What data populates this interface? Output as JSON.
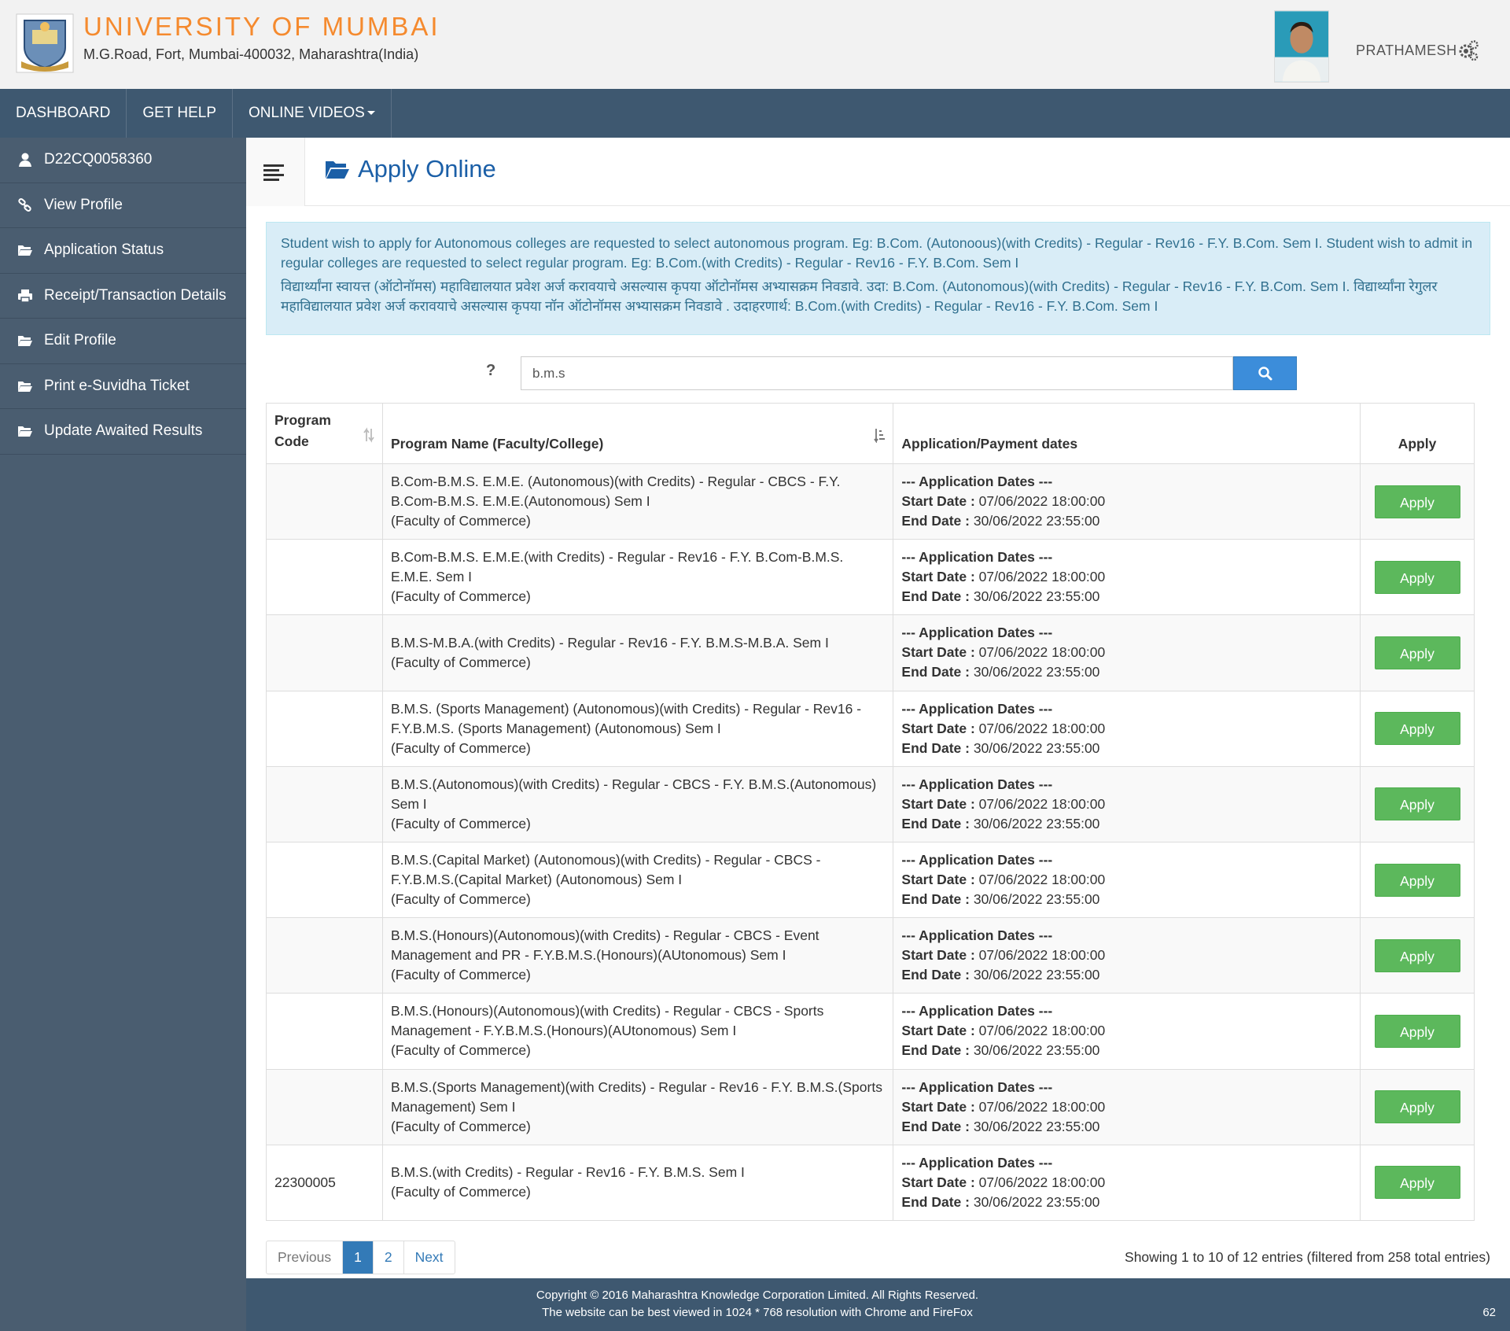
{
  "header": {
    "university": "UNIVERSITY OF MUMBAI",
    "address": "M.G.Road, Fort, Mumbai-400032, Maharashtra(India)",
    "user_name": "PRATHAMESH"
  },
  "nav": {
    "items": [
      "DASHBOARD",
      "GET HELP",
      "ONLINE VIDEOS"
    ]
  },
  "sidebar": {
    "items": [
      {
        "label": "D22CQ0058360",
        "icon": "user-icon"
      },
      {
        "label": "View Profile",
        "icon": "link-icon"
      },
      {
        "label": "Application Status",
        "icon": "folder-open-icon"
      },
      {
        "label": "Receipt/Transaction Details",
        "icon": "print-icon"
      },
      {
        "label": "Edit Profile",
        "icon": "folder-open-icon"
      },
      {
        "label": "Print e-Suvidha Ticket",
        "icon": "folder-open-icon"
      },
      {
        "label": "Update Awaited Results",
        "icon": "folder-open-icon"
      }
    ]
  },
  "page": {
    "title": "Apply Online",
    "alert_en": "Student wish to apply for Autonomous colleges are requested to select autonomous program. Eg: B.Com. (Autonoous)(with Credits) - Regular - Rev16 - F.Y. B.Com. Sem I. Student wish to admit in regular colleges are requested to select regular program. Eg: B.Com.(with Credits) - Regular - Rev16 - F.Y. B.Com. Sem I",
    "alert_mr": "विद्यार्थ्यांना स्वायत्त (ऑटोनॉमस) महाविद्यालयात प्रवेश अर्ज करावयाचे असल्यास कृपया ऑटोनॉमस अभ्यासक्रम निवडावे. उदा: B.Com. (Autonomous)(with Credits) - Regular - Rev16 - F.Y. B.Com. Sem I. विद्यार्थ्यांना रेगुलर महाविद्यालयात प्रवेश अर्ज करावयाचे असल्यास कृपया नॉन ऑटोनॉमस अभ्यासक्रम निवडावे . उदाहरणार्थ: B.Com.(with Credits) - Regular - Rev16 - F.Y. B.Com. Sem I",
    "help_mark": "?",
    "search_value": "b.m.s"
  },
  "table": {
    "headers": {
      "code": "Program Code",
      "name": "Program Name (Faculty/College)",
      "dates": "Application/Payment dates",
      "apply": "Apply"
    },
    "dates_heading": "--- Application Dates ---",
    "start_label": "Start Date :",
    "end_label": "End Date :",
    "apply_label": "Apply",
    "rows": [
      {
        "code": "",
        "name": "B.Com-B.M.S. E.M.E. (Autonomous)(with Credits) - Regular - CBCS - F.Y. B.Com-B.M.S. E.M.E.(Autonomous) Sem I",
        "faculty": "(Faculty of Commerce)",
        "start": "07/06/2022 18:00:00",
        "end": "30/06/2022 23:55:00"
      },
      {
        "code": "",
        "name": "B.Com-B.M.S. E.M.E.(with Credits) - Regular - Rev16 - F.Y. B.Com-B.M.S. E.M.E. Sem I",
        "faculty": "(Faculty of Commerce)",
        "start": "07/06/2022 18:00:00",
        "end": "30/06/2022 23:55:00"
      },
      {
        "code": "",
        "name": "B.M.S-M.B.A.(with Credits) - Regular - Rev16 - F.Y. B.M.S-M.B.A. Sem I",
        "faculty": "(Faculty of Commerce)",
        "start": "07/06/2022 18:00:00",
        "end": "30/06/2022 23:55:00"
      },
      {
        "code": "",
        "name": "B.M.S. (Sports Management) (Autonomous)(with Credits) - Regular - Rev16 - F.Y.B.M.S. (Sports Management) (Autonomous) Sem I",
        "faculty": "(Faculty of Commerce)",
        "start": "07/06/2022 18:00:00",
        "end": "30/06/2022 23:55:00"
      },
      {
        "code": "",
        "name": "B.M.S.(Autonomous)(with Credits) - Regular - CBCS - F.Y. B.M.S.(Autonomous) Sem I",
        "faculty": "(Faculty of Commerce)",
        "start": "07/06/2022 18:00:00",
        "end": "30/06/2022 23:55:00"
      },
      {
        "code": "",
        "name": "B.M.S.(Capital Market) (Autonomous)(with Credits) - Regular - CBCS - F.Y.B.M.S.(Capital Market) (Autonomous) Sem I",
        "faculty": "(Faculty of Commerce)",
        "start": "07/06/2022 18:00:00",
        "end": "30/06/2022 23:55:00"
      },
      {
        "code": "",
        "name": "B.M.S.(Honours)(Autonomous)(with Credits) - Regular - CBCS - Event Management and PR - F.Y.B.M.S.(Honours)(AUtonomous) Sem I",
        "faculty": "(Faculty of Commerce)",
        "start": "07/06/2022 18:00:00",
        "end": "30/06/2022 23:55:00"
      },
      {
        "code": "",
        "name": "B.M.S.(Honours)(Autonomous)(with Credits) - Regular - CBCS - Sports Management - F.Y.B.M.S.(Honours)(AUtonomous) Sem I",
        "faculty": "(Faculty of Commerce)",
        "start": "07/06/2022 18:00:00",
        "end": "30/06/2022 23:55:00"
      },
      {
        "code": "",
        "name": "B.M.S.(Sports Management)(with Credits) - Regular - Rev16 - F.Y. B.M.S.(Sports Management) Sem I",
        "faculty": "(Faculty of Commerce)",
        "start": "07/06/2022 18:00:00",
        "end": "30/06/2022 23:55:00"
      },
      {
        "code": "22300005",
        "name": "B.M.S.(with Credits) - Regular - Rev16 - F.Y. B.M.S. Sem I",
        "faculty": "(Faculty of Commerce)",
        "start": "07/06/2022 18:00:00",
        "end": "30/06/2022 23:55:00"
      }
    ]
  },
  "pagination": {
    "previous": "Previous",
    "pages": [
      "1",
      "2"
    ],
    "next": "Next",
    "info": "Showing 1 to 10 of 12 entries (filtered from 258 total entries)"
  },
  "footer": {
    "line1": "Copyright © 2016 Maharashtra Knowledge Corporation Limited. All Rights Reserved.",
    "line2": "The website can be best viewed in 1024 * 768 resolution with Chrome and FireFox",
    "counter": "62"
  },
  "colors": {
    "brand_orange": "#f58a2e",
    "nav_bg": "#3e5870",
    "sidebar_bg": "#4a5d70",
    "apply_green": "#5cb85c",
    "search_blue": "#3c8dda",
    "title_blue": "#1b5fa7"
  }
}
